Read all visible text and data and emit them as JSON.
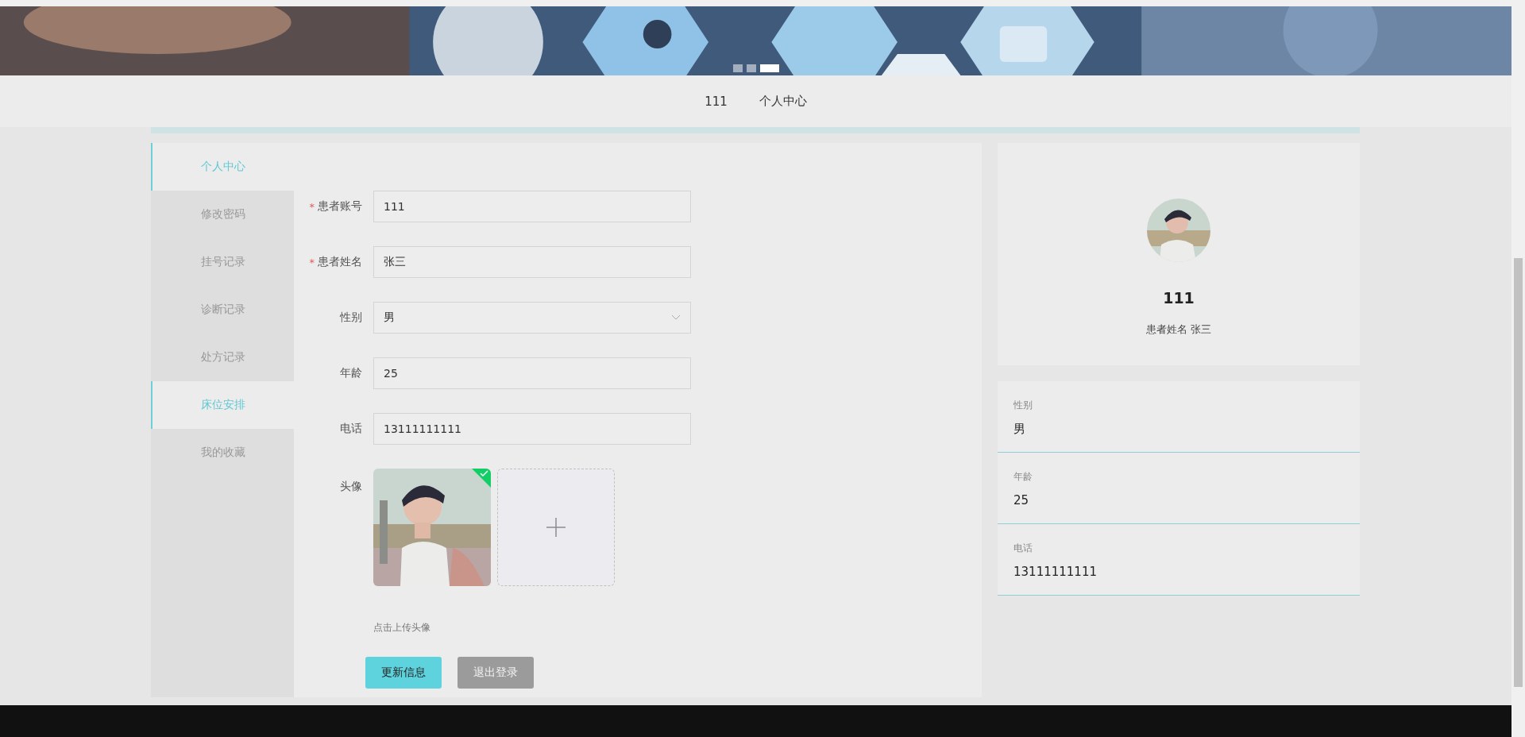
{
  "banner": {
    "kind": "picture",
    "dots": [
      {
        "selected": false
      },
      {
        "selected": false
      },
      {
        "selected": true
      }
    ]
  },
  "nav": {
    "items": [
      "111",
      "个人中心"
    ]
  },
  "menu": [
    {
      "label": "个人中心",
      "highlighted": true
    },
    {
      "label": "修改密码",
      "highlighted": false
    },
    {
      "label": "挂号记录",
      "highlighted": false
    },
    {
      "label": "诊断记录",
      "highlighted": false
    },
    {
      "label": "处方记录",
      "highlighted": false
    },
    {
      "label": "床位安排",
      "highlighted": true
    },
    {
      "label": "我的收藏",
      "highlighted": false
    }
  ],
  "form": {
    "fields": [
      {
        "kind": "input",
        "required_mark": "*",
        "label": "患者账号",
        "value": "111"
      },
      {
        "kind": "input",
        "required_mark": "*",
        "label": "患者姓名",
        "value": "张三"
      },
      {
        "kind": "select",
        "label": "性别",
        "value": "男"
      },
      {
        "kind": "input",
        "label": "年龄",
        "value": "25"
      },
      {
        "kind": "input",
        "label": "电话",
        "value": "13111111111"
      }
    ],
    "avatar": {
      "label": "头像",
      "uploaded": true,
      "hint": "点击上传头像"
    },
    "buttons": [
      {
        "kind": "primary",
        "label": "更新信息"
      },
      {
        "kind": "secondary",
        "label": "退出登录"
      }
    ]
  },
  "profile": {
    "title": "111",
    "subtitle": "患者姓名 张三"
  },
  "details": [
    {
      "label": "性别",
      "value": "男"
    },
    {
      "label": "年龄",
      "value": "25"
    },
    {
      "label": "电话",
      "value": "13111111111"
    }
  ]
}
